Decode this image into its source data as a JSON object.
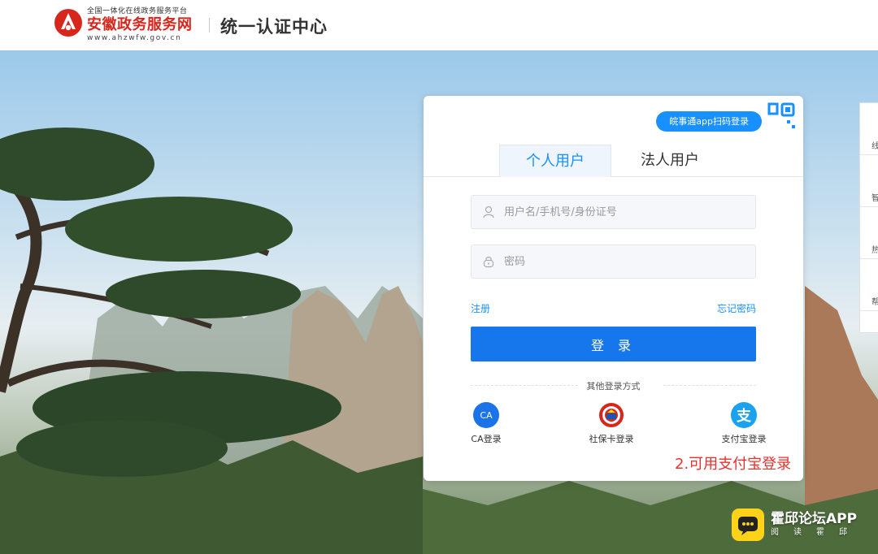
{
  "header": {
    "logo_tagline": "全国一体化在线政务服务平台",
    "logo_name": "安徽政务服务网",
    "logo_url": "www.ahzwfw.gov.cn",
    "title": "统一认证中心"
  },
  "login": {
    "qr_login_label": "皖事通app扫码登录",
    "tabs": [
      {
        "label": "个人用户",
        "active": true
      },
      {
        "label": "法人用户",
        "active": false
      }
    ],
    "username_placeholder": "用户名/手机号/身份证号",
    "password_placeholder": "密码",
    "register_link": "注册",
    "forgot_link": "忘记密码",
    "login_button": "登 录",
    "other_methods_title": "其他登录方式",
    "alt_methods": [
      {
        "label": "CA登录",
        "icon_text": "CA",
        "icon": "ca-icon"
      },
      {
        "label": "社保卡登录",
        "icon_text": "",
        "icon": "social-security-card-icon"
      },
      {
        "label": "支付宝登录",
        "icon_text": "支",
        "icon": "alipay-icon"
      }
    ],
    "annotation": "2.可用支付宝登录"
  },
  "sidebar": {
    "items": [
      {
        "label": "线"
      },
      {
        "label": "智"
      },
      {
        "label": "热"
      },
      {
        "label": "帮"
      }
    ]
  },
  "watermark": {
    "title": "霍邱论坛APP",
    "subtitle": "阅读霍邱"
  },
  "colors": {
    "accent": "#1890ff",
    "button": "#1677ec",
    "brand_red": "#d7261c",
    "annotation": "#e8322d"
  }
}
